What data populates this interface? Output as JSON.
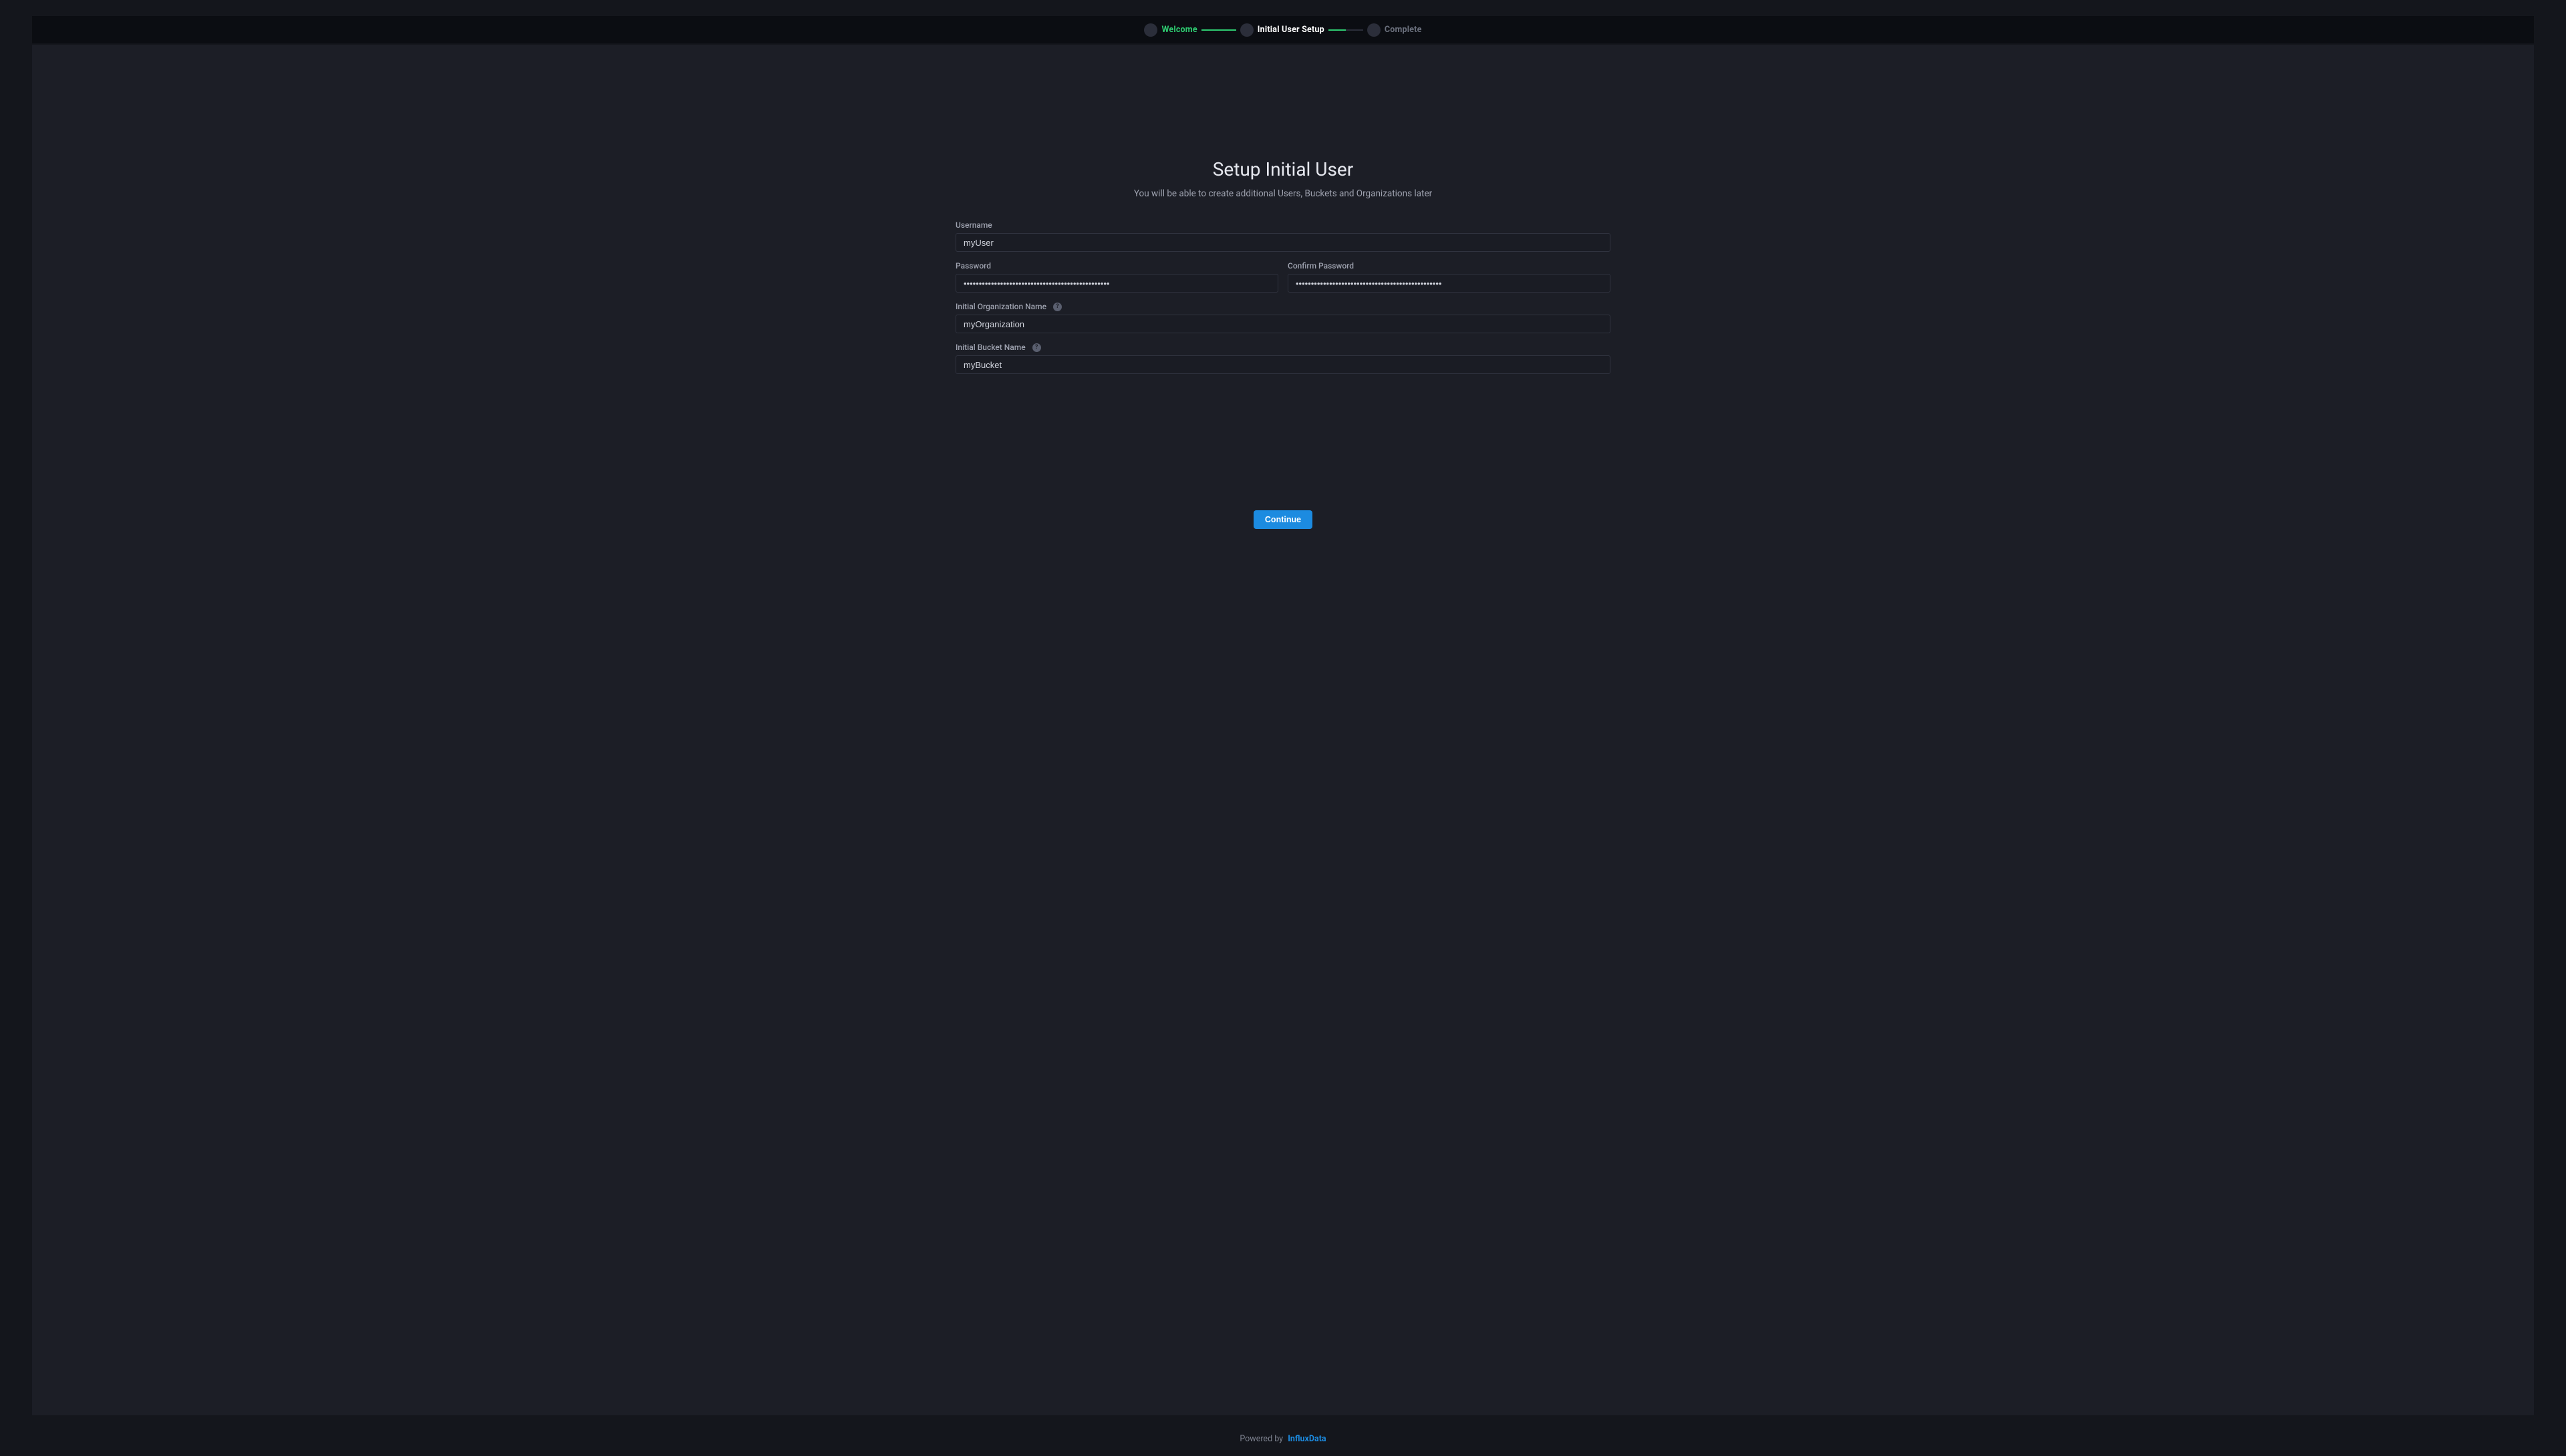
{
  "stepper": {
    "steps": [
      {
        "label": "Welcome",
        "state": "done"
      },
      {
        "label": "Initial User Setup",
        "state": "active"
      },
      {
        "label": "Complete",
        "state": "pending"
      }
    ]
  },
  "page": {
    "title": "Setup Initial User",
    "subtitle": "You will be able to create additional Users, Buckets and Organizations later"
  },
  "form": {
    "username": {
      "label": "Username",
      "value": "myUser"
    },
    "password": {
      "label": "Password",
      "value": "••••••••••••••••••••••••••••••••••••••••••••••••"
    },
    "confirm_password": {
      "label": "Confirm Password",
      "value": "••••••••••••••••••••••••••••••••••••••••••••••••"
    },
    "organization": {
      "label": "Initial Organization Name",
      "value": "myOrganization"
    },
    "bucket": {
      "label": "Initial Bucket Name",
      "value": "myBucket"
    }
  },
  "actions": {
    "continue": "Continue"
  },
  "footer": {
    "powered_by": "Powered by",
    "brand": "InfluxData"
  }
}
